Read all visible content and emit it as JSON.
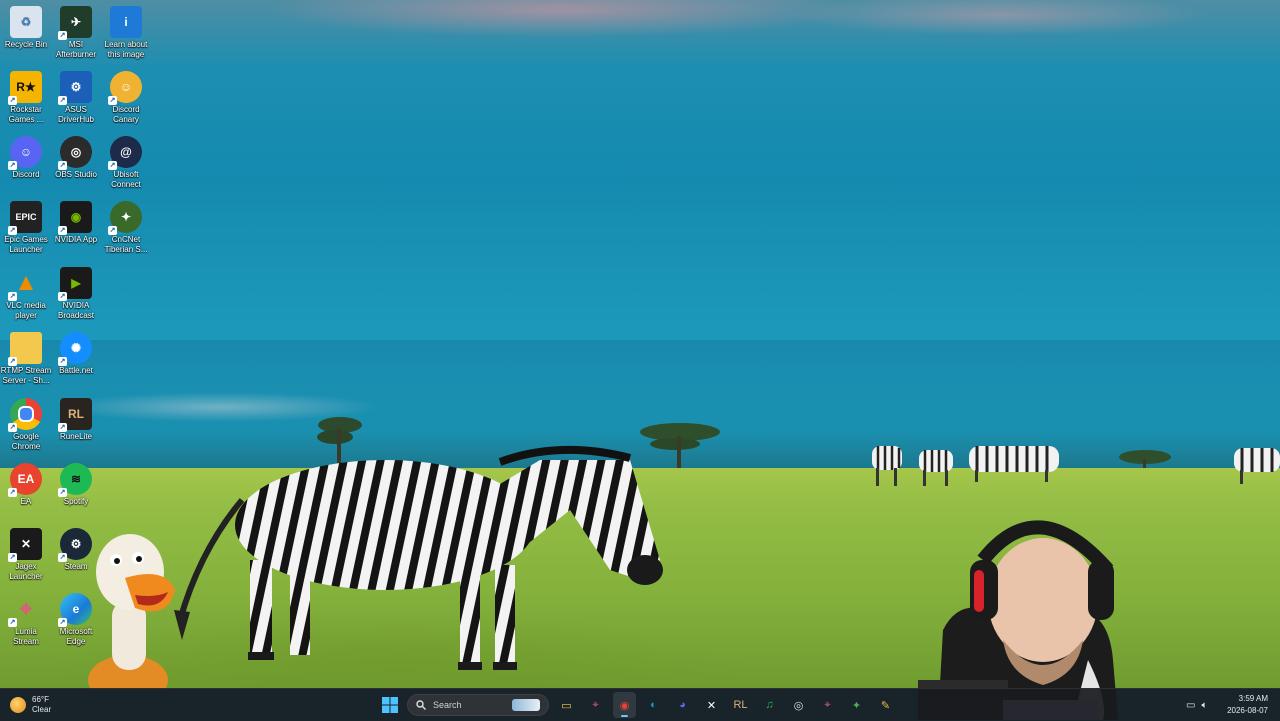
{
  "desktop": {
    "icons": [
      {
        "label": "Recycle Bin",
        "icon": "recycle-bin-icon",
        "color": "#d9e4ee"
      },
      {
        "label": "MSI\nAfterburner",
        "icon": "msi-afterburner-icon",
        "color": "#1f3d2a"
      },
      {
        "label": "Learn about\nthis image",
        "icon": "learn-about-image-icon",
        "color": "#1e7ad6"
      },
      {
        "label": "Rockstar\nGames ...",
        "icon": "rockstar-games-icon",
        "color": "#f4b400"
      },
      {
        "label": "ASUS\nDriverHub",
        "icon": "asus-driverhub-icon",
        "color": "#1b5fb8"
      },
      {
        "label": "Discord\nCanary",
        "icon": "discord-canary-icon",
        "color": "#f0b232"
      },
      {
        "label": "Discord",
        "icon": "discord-icon",
        "color": "#5865f2"
      },
      {
        "label": "OBS Studio",
        "icon": "obs-studio-icon",
        "color": "#2b2b2b"
      },
      {
        "label": "Ubisoft\nConnect",
        "icon": "ubisoft-connect-icon",
        "color": "#1d2a4a"
      },
      {
        "label": "Epic Games\nLauncher",
        "icon": "epic-games-icon",
        "color": "#222222"
      },
      {
        "label": "NVIDIA App",
        "icon": "nvidia-app-icon",
        "color": "#76b900"
      },
      {
        "label": "CnCNet\nTiberian S...",
        "icon": "cncnet-icon",
        "color": "#3a6a2a"
      },
      {
        "label": "VLC media\nplayer",
        "icon": "vlc-icon",
        "color": "#f18b00"
      },
      {
        "label": "NVIDIA\nBroadcast",
        "icon": "nvidia-broadcast-icon",
        "color": "#76b900"
      },
      {
        "label": "RTMP Stream\nServer - Sh...",
        "icon": "folder-icon",
        "color": "#f2c94c"
      },
      {
        "label": "Battle.net",
        "icon": "battlenet-icon",
        "color": "#148eff"
      },
      {
        "label": "Google\nChrome",
        "icon": "chrome-icon",
        "color": "#ea4335"
      },
      {
        "label": "RuneLite",
        "icon": "runelite-icon",
        "color": "#4a3a2a"
      },
      {
        "label": "EA",
        "icon": "ea-icon",
        "color": "#e8432c"
      },
      {
        "label": "Spotify",
        "icon": "spotify-icon",
        "color": "#1db954"
      },
      {
        "label": "Jagex\nLauncher",
        "icon": "jagex-launcher-icon",
        "color": "#1a1a1a"
      },
      {
        "label": "Steam",
        "icon": "steam-icon",
        "color": "#1b2838"
      },
      {
        "label": "Lumia\nStream",
        "icon": "lumia-stream-icon",
        "color": "#e05a7a"
      },
      {
        "label": "Microsoft\nEdge",
        "icon": "edge-icon",
        "color": "#1a9ad6"
      }
    ]
  },
  "taskbar": {
    "weather": {
      "temp": "66°F",
      "condition": "Clear"
    },
    "search_placeholder": "Search",
    "apps": [
      {
        "name": "file-explorer",
        "glyph": "▭",
        "color": "#f2c94c",
        "active": false
      },
      {
        "name": "lumia-stream",
        "glyph": "⌖",
        "color": "#e05a7a",
        "active": false
      },
      {
        "name": "chrome",
        "glyph": "◉",
        "color": "#ea4335",
        "active": true
      },
      {
        "name": "edge",
        "glyph": "◐",
        "color": "#1a9ad6",
        "active": false
      },
      {
        "name": "discord",
        "glyph": "◕",
        "color": "#5865f2",
        "active": false
      },
      {
        "name": "jagex-launcher",
        "glyph": "✕",
        "color": "#ffffff",
        "active": false
      },
      {
        "name": "runelite",
        "glyph": "RL",
        "color": "#d9b27c",
        "active": false
      },
      {
        "name": "spotify",
        "glyph": "♫",
        "color": "#1db954",
        "active": false
      },
      {
        "name": "obs-studio",
        "glyph": "◎",
        "color": "#dddddd",
        "active": false
      },
      {
        "name": "lumia-stream-2",
        "glyph": "⌖",
        "color": "#e05a7a",
        "active": false
      },
      {
        "name": "cncnet",
        "glyph": "✦",
        "color": "#4caf50",
        "active": false
      },
      {
        "name": "other-app",
        "glyph": "✎",
        "color": "#e0c04a",
        "active": false
      }
    ],
    "clock": {
      "time": "3:59 AM",
      "date": "2026-08-07"
    }
  }
}
